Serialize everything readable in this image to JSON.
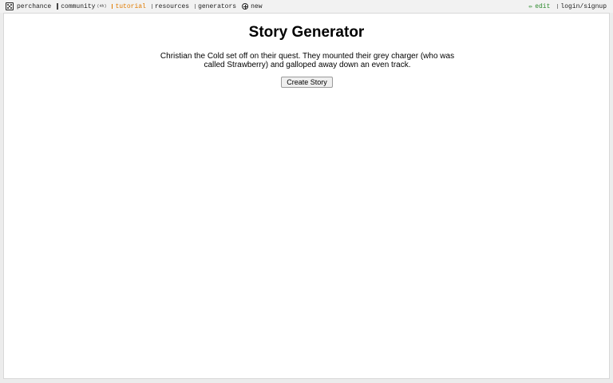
{
  "nav": {
    "brand": "perchance",
    "community": "community",
    "community_count": "(4h)",
    "tutorial": "tutorial",
    "resources": "resources",
    "generators": "generators",
    "new": "new",
    "edit": "edit",
    "login": "login/signup"
  },
  "main": {
    "title": "Story Generator",
    "story": "Christian the Cold set off on their quest. They mounted their grey charger (who was called Strawberry) and galloped away down an even track.",
    "button_label": "Create Story"
  },
  "colors": {
    "tutorial": "#e07b00",
    "edit": "#2e8b2e"
  }
}
